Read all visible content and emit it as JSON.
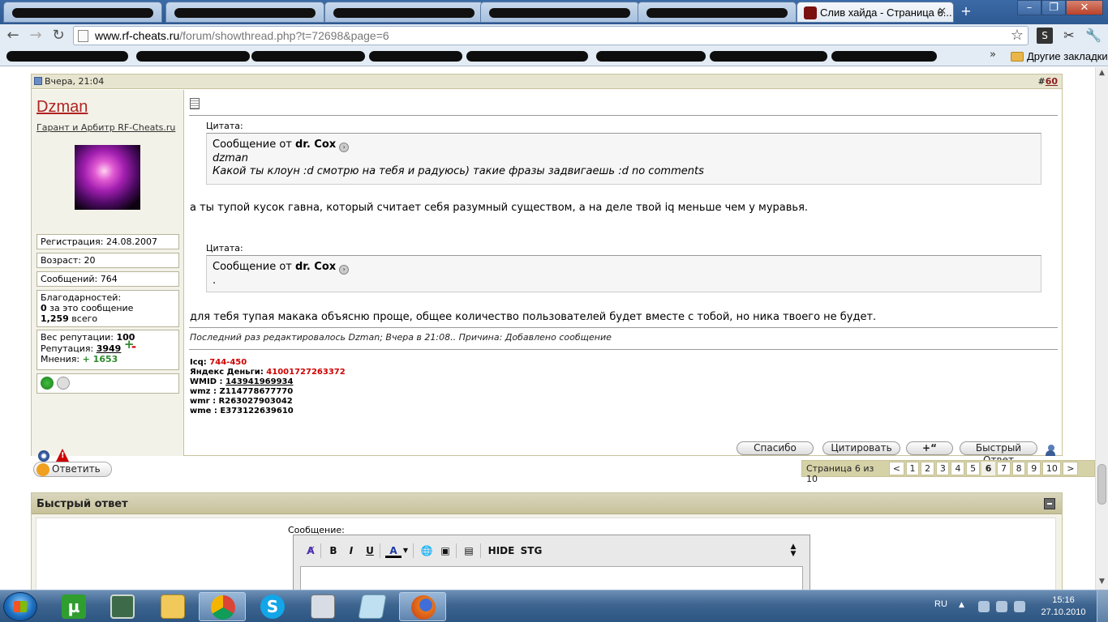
{
  "browser": {
    "active_tab_title": "Слив хайда - Страница 6...",
    "url_host": "www.rf-cheats.ru",
    "url_path": "/forum/showthread.php?t=72698&page=6",
    "other_bookmarks": "Другие закладки",
    "window_buttons": [
      "–",
      "❐",
      "✕"
    ]
  },
  "post": {
    "date": "Вчера, 21:04",
    "number_prefix": "#",
    "number": "60",
    "username": "Dzman",
    "user_title": "Гарант и Арбитр RF-Cheats.ru",
    "registration": "Регистрация: 24.08.2007",
    "age": "Возраст: 20",
    "messages": "Сообщений: 764",
    "thanks": {
      "title": "Благодарностей:",
      "this_post_count": "0",
      "this_post_label": " за это сообщение",
      "total_count": "1,259",
      "total_label": " всего"
    },
    "reputation": {
      "weight_label": "Вес репутации: ",
      "weight_value": "100",
      "rep_label": "Репутация: ",
      "rep_value": "3949",
      "opinions_label": "Мнения: ",
      "opinions_value": "+ 1653"
    },
    "quotes": [
      {
        "label": "Цитата:",
        "from_prefix": "Сообщение от ",
        "author": "dr. Cox",
        "lines": [
          "dzman",
          "Какой ты клоун :d смотрю на тебя и радуюсь) такие фразы задвигаешь :d no comments"
        ]
      },
      {
        "label": "Цитата:",
        "from_prefix": "Сообщение от ",
        "author": "dr. Cox",
        "lines": [
          "."
        ]
      }
    ],
    "text_1": "а ты тупой кусок гавна, который считает себя разумный существом, а на деле твой iq меньше чем у муравья.",
    "text_2": "для тебя тупая макака объясню проще, общее количество пользователей будет вместе с тобой, но ника твоего не будет.",
    "edited": "Последний раз редактировалось Dzman; Вчера в 21:08.. Причина: Добавлено сообщение",
    "signature": {
      "icq_label": "Icq: ",
      "icq_value": "744-450",
      "yandex_label": "Яндекс Деньги: ",
      "yandex_value": "41001727263372",
      "wmid_label": "WMID : ",
      "wmid_value": "143941969934",
      "wmz": "wmz : Z114778677770",
      "wmr": "wmr : R263027903042",
      "wme": "wme : E373122639610"
    },
    "buttons": {
      "thanks": "Спасибо",
      "quote": "Цитировать",
      "multiquote": "+“",
      "quick_reply": "Быстрый Ответ"
    }
  },
  "reply_button": "Ответить",
  "pager": {
    "label": "Страница 6 из 10",
    "prev": "<",
    "pages": [
      "1",
      "2",
      "3",
      "4",
      "5",
      "6",
      "7",
      "8",
      "9",
      "10"
    ],
    "current": "6",
    "next": ">"
  },
  "quick_reply": {
    "title": "Быстрый ответ",
    "message_label": "Сообщение:",
    "toolbar": [
      "B",
      "I",
      "U",
      "A",
      "HIDE",
      "STG"
    ]
  },
  "taskbar": {
    "language": "RU",
    "time": "15:16",
    "date": "27.10.2010"
  },
  "colors": {
    "username": "#b22222",
    "signature_red": "#d00000",
    "positive": "#2e8b2e",
    "post_header_bg": "#e7e5cf"
  }
}
